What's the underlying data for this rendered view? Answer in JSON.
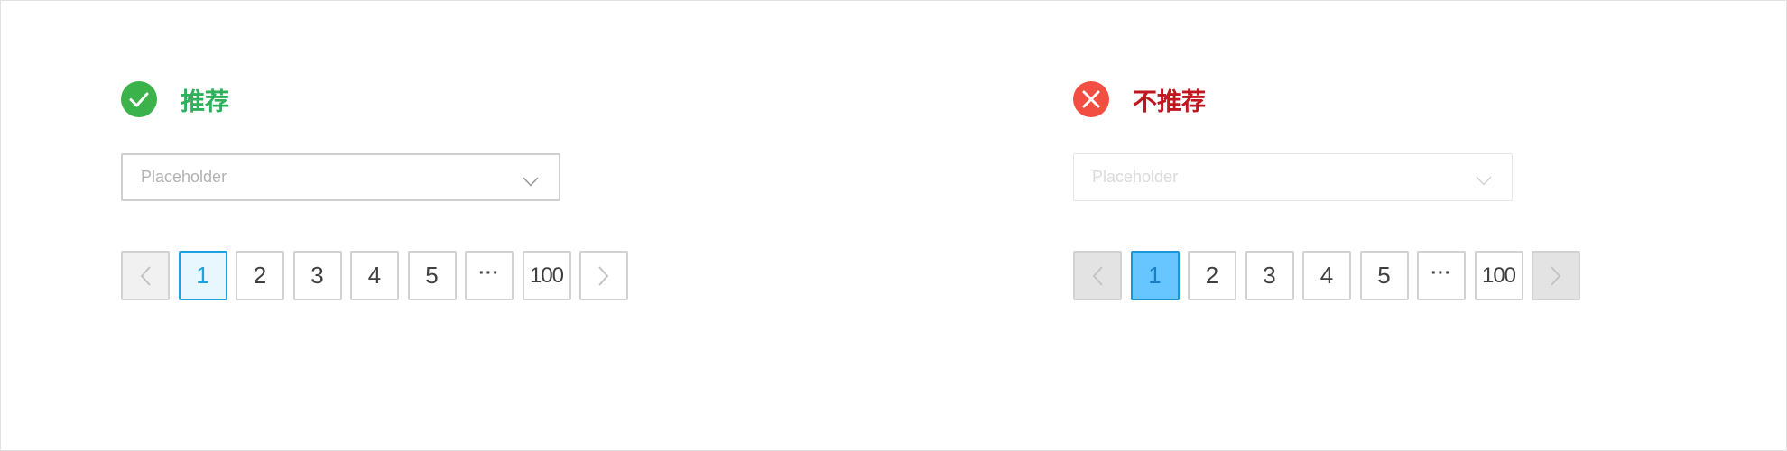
{
  "recommended": {
    "title": "推荐",
    "title_color": "#2eb15a",
    "badge_color": "#3bb34a",
    "select_placeholder": "Placeholder",
    "pages": [
      "1",
      "2",
      "3",
      "4",
      "5",
      "···",
      "100"
    ],
    "current_page": "1"
  },
  "not_recommended": {
    "title": "不推荐",
    "title_color": "#c0171f",
    "badge_color": "#f24e42",
    "select_placeholder": "Placeholder",
    "pages": [
      "1",
      "2",
      "3",
      "4",
      "5",
      "···",
      "100"
    ],
    "current_page": "1"
  },
  "icons": {
    "recommended_badge": "check-circle-icon",
    "not_recommended_badge": "close-circle-icon",
    "select_caret": "chevron-down-icon",
    "prev": "chevron-left-icon",
    "next": "chevron-right-icon"
  }
}
